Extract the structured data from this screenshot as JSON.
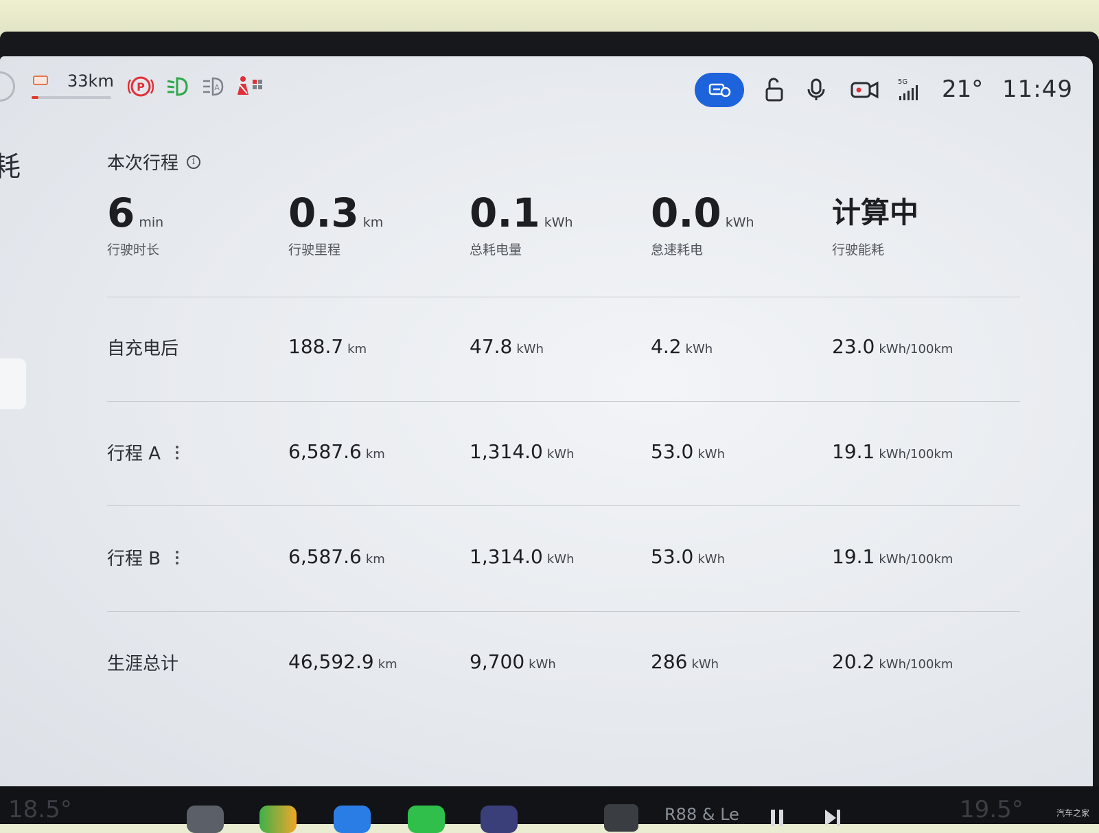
{
  "status": {
    "range": "33km",
    "range_fraction": 0.09,
    "temperature": "21°",
    "time": "11:49",
    "network": "5G",
    "accent_color": "#1d64dc",
    "range_warning_color": "#e03a2c",
    "indicator_icons": [
      "battery-low-icon",
      "parking-brake-icon",
      "low-beam-icon",
      "auto-headlight-icon",
      "seatbelt-warning-icon"
    ],
    "quick_icons": [
      "camera-toggle-icon",
      "unlock-icon",
      "microphone-icon",
      "dashcam-icon",
      "signal-icon"
    ]
  },
  "sidebar": {
    "partial_title": "耗"
  },
  "trip": {
    "title": "本次行程",
    "stats": [
      {
        "value": "6",
        "unit": "min",
        "label": "行驶时长"
      },
      {
        "value": "0.3",
        "unit": "km",
        "label": "行驶里程"
      },
      {
        "value": "0.1",
        "unit": "kWh",
        "label": "总耗电量"
      },
      {
        "value": "0.0",
        "unit": "kWh",
        "label": "怠速耗电"
      },
      {
        "value": "计算中",
        "unit": "",
        "label": "行驶能耗"
      }
    ]
  },
  "rows": [
    {
      "label": "自充电后",
      "has_menu": false,
      "cells": [
        {
          "v": "188.7",
          "u": "km"
        },
        {
          "v": "47.8",
          "u": "kWh"
        },
        {
          "v": "4.2",
          "u": "kWh"
        },
        {
          "v": "23.0",
          "u": "kWh/100km"
        }
      ]
    },
    {
      "label": "行程 A",
      "has_menu": true,
      "cells": [
        {
          "v": "6,587.6",
          "u": "km"
        },
        {
          "v": "1,314.0",
          "u": "kWh"
        },
        {
          "v": "53.0",
          "u": "kWh"
        },
        {
          "v": "19.1",
          "u": "kWh/100km"
        }
      ]
    },
    {
      "label": "行程 B",
      "has_menu": true,
      "cells": [
        {
          "v": "6,587.6",
          "u": "km"
        },
        {
          "v": "1,314.0",
          "u": "kWh"
        },
        {
          "v": "53.0",
          "u": "kWh"
        },
        {
          "v": "19.1",
          "u": "kWh/100km"
        }
      ]
    },
    {
      "label": "生涯总计",
      "has_menu": false,
      "cells": [
        {
          "v": "46,592.9",
          "u": "km"
        },
        {
          "v": "9,700",
          "u": "kWh"
        },
        {
          "v": "286",
          "u": "kWh"
        },
        {
          "v": "20.2",
          "u": "kWh/100km"
        }
      ]
    }
  ],
  "dock": {
    "left_temp": "18.5°",
    "right_temp": "19.5°",
    "media_title": "R88 & Le",
    "watermark": "汽车之家",
    "apps": [
      "settings-app-icon",
      "navigation-app-icon",
      "video-call-app-icon",
      "phone-app-icon",
      "app-store-icon"
    ]
  }
}
